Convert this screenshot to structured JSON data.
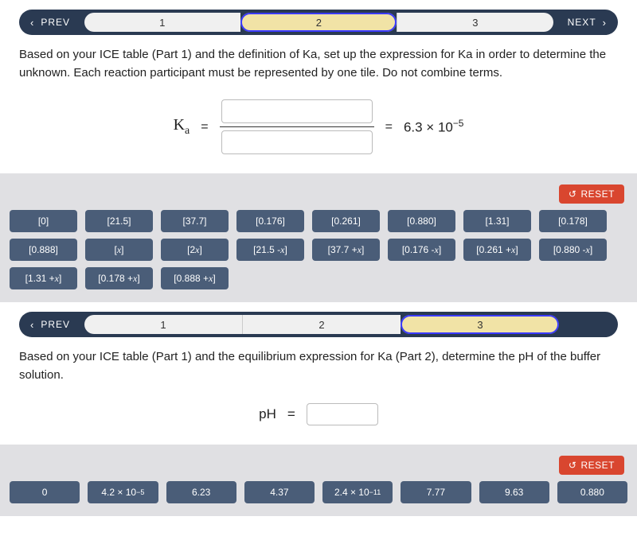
{
  "section1": {
    "nav": {
      "prev": "PREV",
      "next": "NEXT",
      "steps": [
        "1",
        "2",
        "3"
      ],
      "active": 1
    },
    "instruction": "Based on your ICE table (Part 1) and the definition of Ka, set up the expression for Ka in order to determine the unknown. Each reaction participant must be represented by one tile. Do not combine terms.",
    "ka_label": "K",
    "ka_sub": "a",
    "equals": "=",
    "rhs_value": "6.3 × 10",
    "rhs_exp": "−5",
    "reset": "RESET",
    "tiles": [
      {
        "t": "[0]"
      },
      {
        "t": "[21.5]"
      },
      {
        "t": "[37.7]"
      },
      {
        "t": "[0.176]"
      },
      {
        "t": "[0.261]"
      },
      {
        "t": "[0.880]"
      },
      {
        "t": "[1.31]"
      },
      {
        "t": "[0.178]"
      },
      {
        "t": "[0.888]"
      },
      {
        "t": "[x]",
        "i": 1
      },
      {
        "t": "[2x]",
        "i": 1
      },
      {
        "t": "[21.5 - x]",
        "i": 1
      },
      {
        "t": "[37.7 + x]",
        "i": 1
      },
      {
        "t": "[0.176 - x]",
        "i": 1
      },
      {
        "t": "[0.261 + x]",
        "i": 1
      },
      {
        "t": "[0.880 - x]",
        "i": 1
      },
      {
        "t": "[1.31 + x]",
        "i": 1
      },
      {
        "t": "[0.178 + x]",
        "i": 1
      },
      {
        "t": "[0.888 + x]",
        "i": 1
      }
    ]
  },
  "section2": {
    "nav": {
      "prev": "PREV",
      "steps": [
        "1",
        "2",
        "3"
      ],
      "active": 2
    },
    "instruction": "Based on your ICE table (Part 1) and the equilibrium expression for Ka (Part 2), determine the pH of the buffer solution.",
    "ph_label": "pH",
    "equals": "=",
    "reset": "RESET",
    "tiles": [
      {
        "t": "0"
      },
      {
        "t": "4.2 × 10",
        "e": "−5"
      },
      {
        "t": "6.23"
      },
      {
        "t": "4.37"
      },
      {
        "t": "2.4 × 10",
        "e": "−11"
      },
      {
        "t": "7.77"
      },
      {
        "t": "9.63"
      },
      {
        "t": "0.880"
      }
    ]
  }
}
